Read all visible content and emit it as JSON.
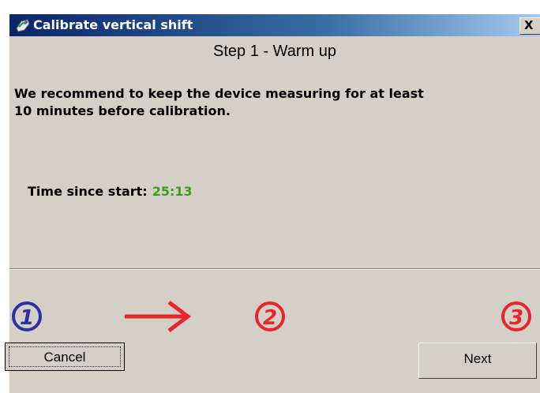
{
  "window": {
    "title": "Calibrate vertical shift",
    "close_label": "X"
  },
  "step": {
    "title": "Step 1 - Warm up",
    "description_line1": "We recommend to keep the device measuring for at least",
    "description_line2": "10 minutes before calibration."
  },
  "timer": {
    "label": "Time since start:",
    "value": "25:13"
  },
  "steps_indicator": {
    "items": [
      "1",
      "2",
      "3"
    ],
    "current": 1,
    "active_color": "#3030a0",
    "inactive_color": "#e8242c",
    "arrow_color": "#e8242c"
  },
  "buttons": {
    "cancel": "Cancel",
    "next": "Next"
  },
  "colors": {
    "dialog_bg": "#d4d0c8",
    "timer_value": "#3c9c1c"
  }
}
